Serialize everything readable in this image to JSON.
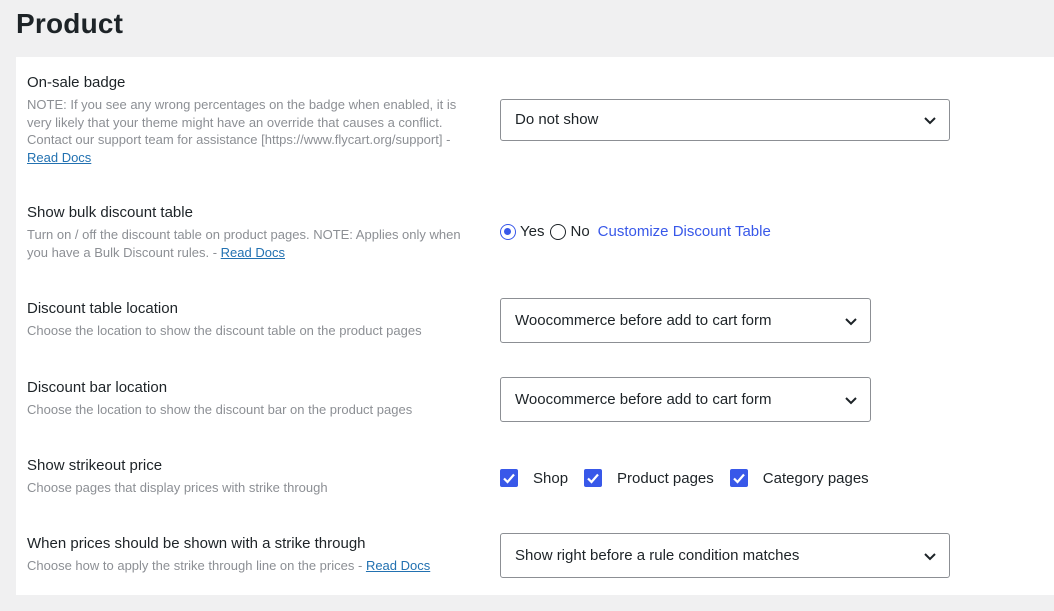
{
  "page": {
    "title": "Product"
  },
  "rows": {
    "onsale": {
      "title": "On-sale badge",
      "desc": "NOTE: If you see any wrong percentages on the badge when enabled, it is very likely that your theme might have an override that causes a conflict. Contact our support team for assistance [https://www.flycart.org/support] -",
      "link": "Read Docs",
      "select_value": "Do not show"
    },
    "bulk": {
      "title": "Show bulk discount table",
      "desc": "Turn on / off the discount table on product pages. NOTE: Applies only when you have a Bulk Discount rules. -",
      "link": "Read Docs",
      "opt_yes": "Yes",
      "opt_no": "No",
      "selected": "Yes",
      "customize_link": "Customize Discount Table"
    },
    "table_location": {
      "title": "Discount table location",
      "desc": "Choose the location to show the discount table on the product pages",
      "select_value": "Woocommerce before add to cart form"
    },
    "bar_location": {
      "title": "Discount bar location",
      "desc": "Choose the location to show the discount bar on the product pages",
      "select_value": "Woocommerce before add to cart form"
    },
    "strikeout": {
      "title": "Show strikeout price",
      "desc": "Choose pages that display prices with strike through",
      "options": [
        {
          "label": "Shop",
          "checked": true
        },
        {
          "label": "Product pages",
          "checked": true
        },
        {
          "label": "Category pages",
          "checked": true
        }
      ]
    },
    "strike_when": {
      "title": "When prices should be shown with a strike through",
      "desc": "Choose how to apply the strike through line on the prices -",
      "link": "Read Docs",
      "select_value": "Show right before a rule condition matches"
    }
  },
  "colors": {
    "accent": "#3858e9",
    "link": "#2271b1",
    "muted": "#8c8f94"
  }
}
